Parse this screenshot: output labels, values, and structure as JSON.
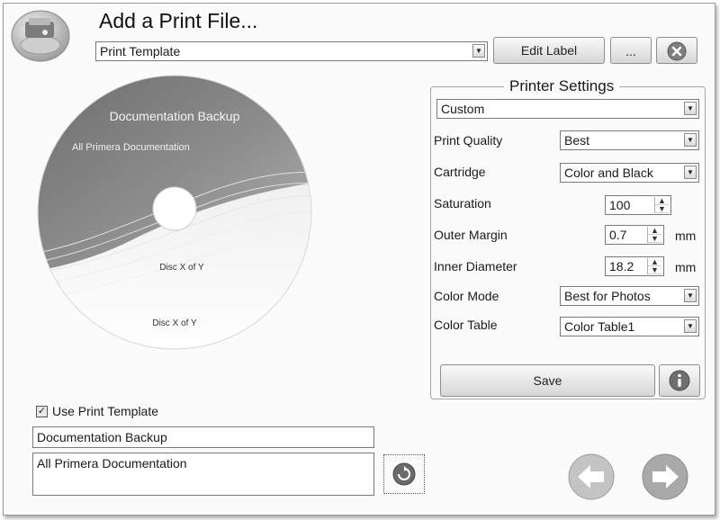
{
  "header": {
    "title": "Add a Print File...",
    "template_select": "Print Template",
    "edit_label_button": "Edit Label",
    "more_button": "..."
  },
  "disc": {
    "title": "Documentation Backup",
    "subtitle": "All Primera Documentation",
    "disc_label_1": "Disc X of Y",
    "disc_label_2": "Disc X of Y"
  },
  "printer_settings": {
    "legend": "Printer Settings",
    "preset": "Custom",
    "rows": {
      "print_quality": {
        "label": "Print Quality",
        "value": "Best"
      },
      "cartridge": {
        "label": "Cartridge",
        "value": "Color and Black"
      },
      "saturation": {
        "label": "Saturation",
        "value": "100"
      },
      "outer_margin": {
        "label": "Outer Margin",
        "value": "0.7",
        "unit": "mm"
      },
      "inner_diameter": {
        "label": "Inner Diameter",
        "value": "18.2",
        "unit": "mm"
      },
      "color_mode": {
        "label": "Color Mode",
        "value": "Best for Photos"
      },
      "color_table": {
        "label": "Color Table",
        "value": "Color Table1"
      }
    },
    "save_button": "Save"
  },
  "footer": {
    "use_template_label": "Use Print Template",
    "use_template_checked": true,
    "title_field": "Documentation Backup",
    "subtitle_field": "All Primera Documentation"
  },
  "icons": {
    "logo": "disc-printer-icon",
    "close": "close-icon",
    "info": "info-icon",
    "refresh": "refresh-icon",
    "back": "arrow-left-icon",
    "next": "arrow-right-icon"
  },
  "colors": {
    "accent": "#8a8a8a",
    "background": "#fbfbfb"
  }
}
